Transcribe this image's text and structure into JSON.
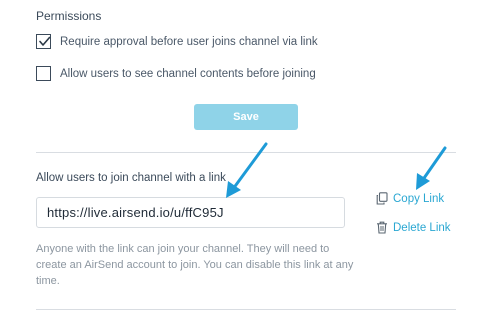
{
  "permissions": {
    "title": "Permissions",
    "options": [
      {
        "label": "Require approval before user joins channel via link",
        "checked": true
      },
      {
        "label": "Allow users to see channel contents before joining",
        "checked": false
      }
    ],
    "save_label": "Save"
  },
  "link_section": {
    "title": "Allow users to join channel with a link",
    "url": "https://live.airsend.io/u/ffC95J",
    "copy_label": "Copy Link",
    "delete_label": "Delete Link",
    "help_text": "Anyone with the link can join your channel. They will need to create an AirSend account to join. You can disable this link at any time."
  },
  "colors": {
    "accent": "#2aa7d2",
    "save_button": "#8fd3e8",
    "annotation_arrow": "#1e9bd7"
  },
  "icons": {
    "copy": "copy-icon",
    "delete": "trash-icon",
    "checkmark": "checkmark-icon"
  }
}
